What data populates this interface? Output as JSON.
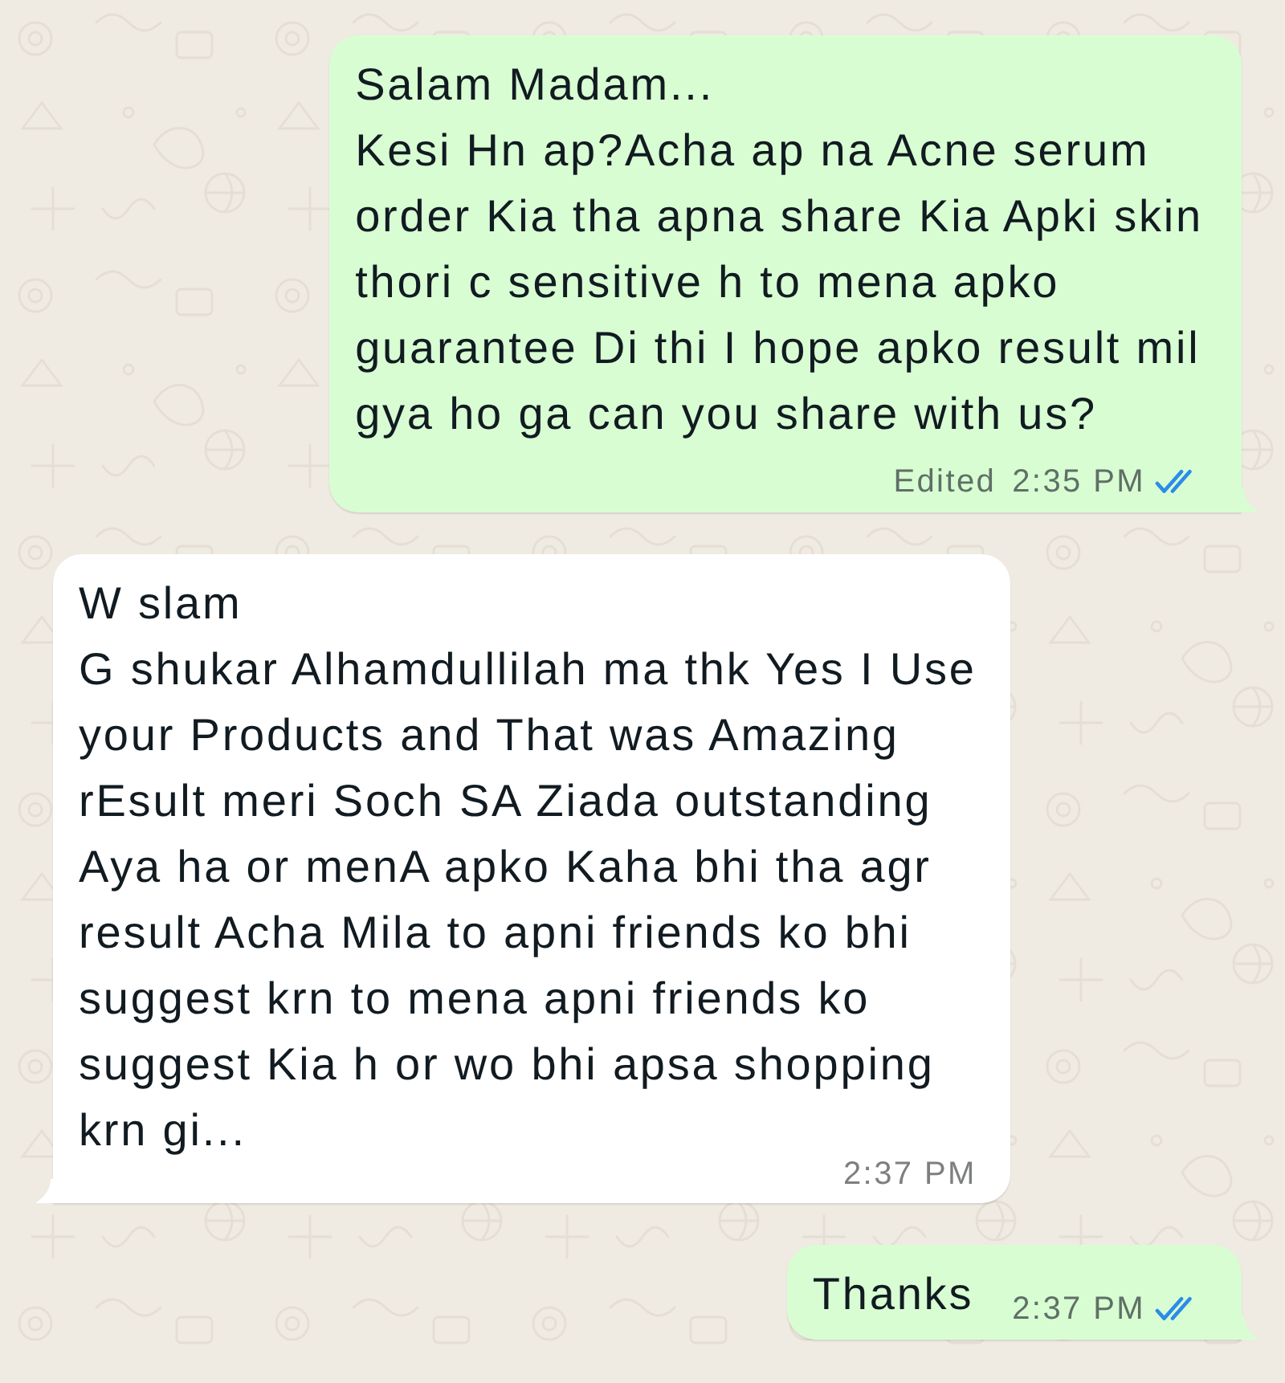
{
  "messages": [
    {
      "kind": "outgoing",
      "text": "Salam Madam...\nKesi Hn ap?Acha ap na Acne serum\norder Kia tha apna share Kia Apki skin\nthori c sensitive h to mena apko\nguarantee Di thi I hope apko result mil\ngya ho ga can you share with us?",
      "edited_label": "Edited",
      "time": "2:35 PM",
      "read": true
    },
    {
      "kind": "incoming",
      "text": "W slam\nG shukar Alhamdullilah ma thk Yes I Use\nyour Products and That was Amazing\nrEsult meri Soch SA Ziada outstanding\nAya ha or menA apko Kaha bhi tha agr\nresult Acha Mila to apni friends ko bhi\nsuggest krn to mena apni friends ko\nsuggest Kia h or wo bhi apsa shopping\nkrn gi...",
      "time": "2:37 PM"
    },
    {
      "kind": "outgoing",
      "text": "Thanks",
      "time": "2:37 PM",
      "read": true
    }
  ]
}
